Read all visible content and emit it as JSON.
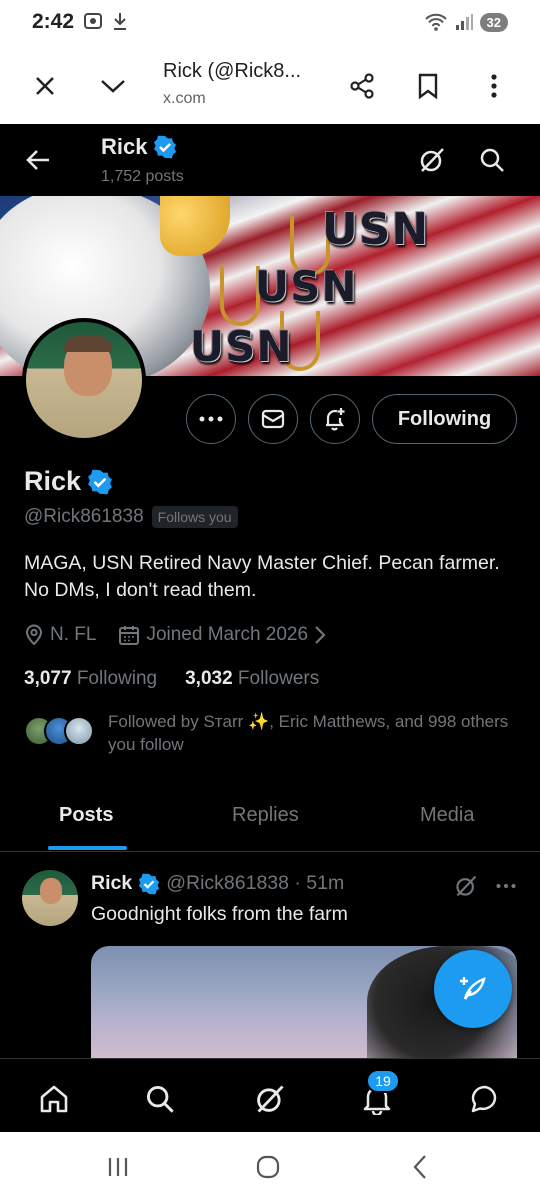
{
  "status_bar": {
    "time": "2:42",
    "battery": "32"
  },
  "browser": {
    "title": "Rick (@Rick8...",
    "url": "x.com"
  },
  "header": {
    "name": "Rick",
    "posts": "1,752 posts"
  },
  "banner": {
    "text1": "USN",
    "text2": "USN",
    "text3": "USN"
  },
  "actions": {
    "following_label": "Following"
  },
  "profile": {
    "name": "Rick",
    "handle": "@Rick861838",
    "follows_you": "Follows you",
    "bio": "MAGA, USN Retired Navy Master Chief. Pecan farmer. No DMs, I don't read them.",
    "location": "N. FL",
    "joined": "Joined March 2026",
    "following_count": "3,077",
    "following_label": "Following",
    "followers_count": "3,032",
    "followers_label": "Followers",
    "followed_by": "Followed by Sтarr ✨, Eric Matthews, and 998 others you follow"
  },
  "tabs": [
    "Posts",
    "Replies",
    "Media"
  ],
  "post": {
    "author": "Rick",
    "meta": "@Rick861838 · 51m",
    "text": "Goodnight folks from the farm"
  },
  "bottom_nav": {
    "notifications_badge": "19"
  },
  "colors": {
    "accent": "#1d9bf0",
    "background": "#000000",
    "muted": "#71767b"
  },
  "icons": [
    "close-icon",
    "chevron-down-icon",
    "share-icon",
    "bookmark-icon",
    "more-vertical-icon",
    "back-arrow-icon",
    "grok-icon",
    "search-icon",
    "verified-badge-icon",
    "more-horizontal-icon",
    "mail-icon",
    "bell-plus-icon",
    "location-icon",
    "calendar-icon",
    "compose-icon",
    "home-icon",
    "bell-icon",
    "messages-icon"
  ]
}
